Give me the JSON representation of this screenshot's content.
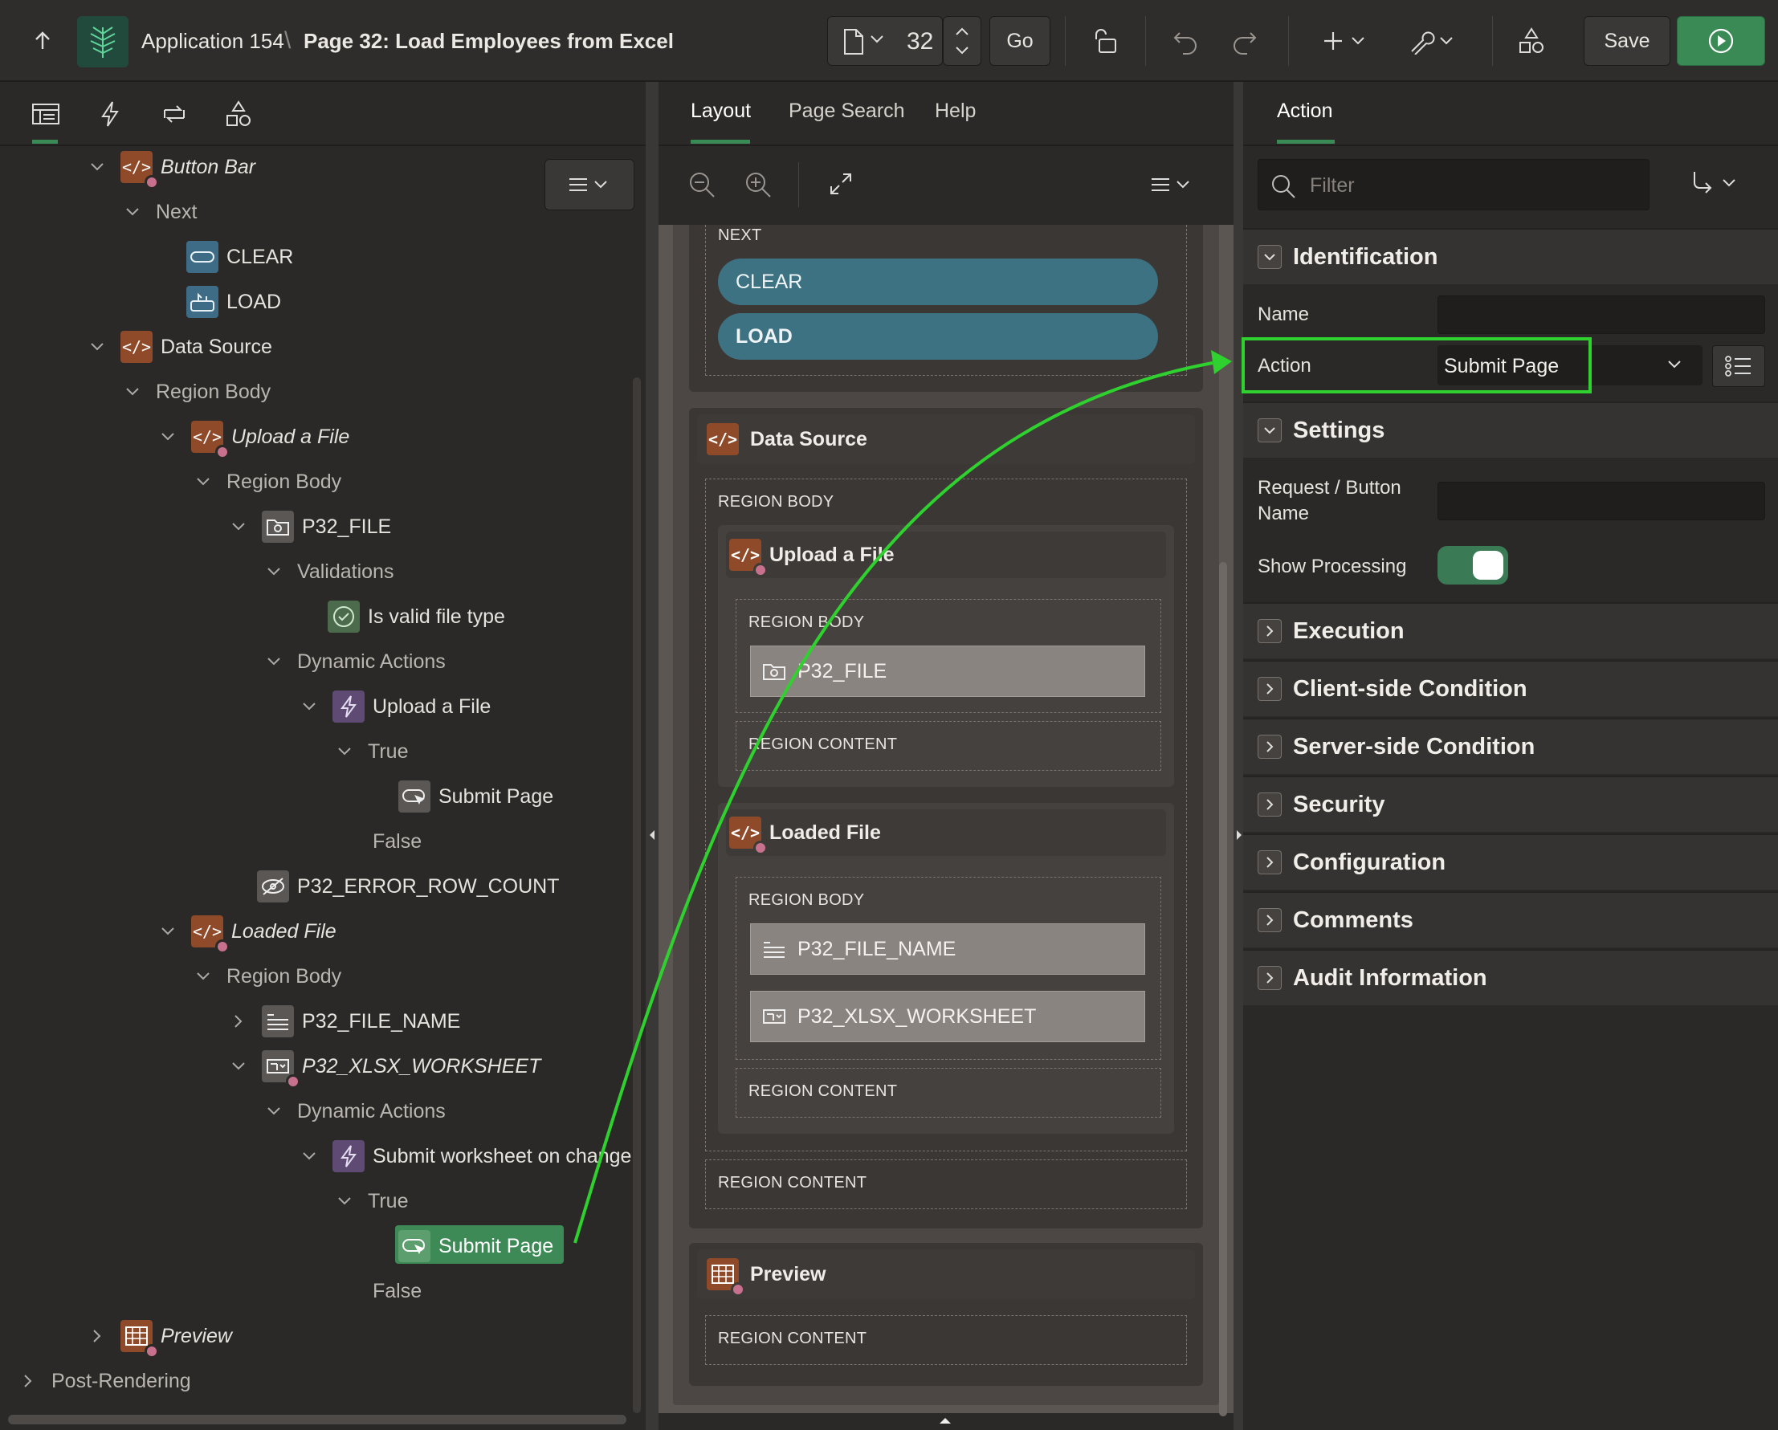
{
  "header": {
    "app_name": "Application 154",
    "separator": "\\",
    "page_title": "Page 32: Load Employees from Excel",
    "page_number": "32",
    "go_label": "Go",
    "save_label": "Save"
  },
  "tree": {
    "button_bar": "Button Bar",
    "next": "Next",
    "clear": "CLEAR",
    "load": "LOAD",
    "data_source": "Data Source",
    "region_body_1": "Region Body",
    "upload_file": "Upload a File",
    "region_body_2": "Region Body",
    "p32_file": "P32_FILE",
    "validations": "Validations",
    "valid_file_type": "Is valid file type",
    "dynamic_actions_1": "Dynamic Actions",
    "da_upload": "Upload a File",
    "true_1": "True",
    "submit_page_1": "Submit Page",
    "false_1": "False",
    "error_row_count": "P32_ERROR_ROW_COUNT",
    "loaded_file": "Loaded File",
    "region_body_3": "Region Body",
    "file_name": "P32_FILE_NAME",
    "xlsx_worksheet": "P32_XLSX_WORKSHEET",
    "dynamic_actions_2": "Dynamic Actions",
    "da_submit_ws": "Submit worksheet on change",
    "true_2": "True",
    "submit_page_2": "Submit Page",
    "false_2": "False",
    "preview": "Preview",
    "post_rendering": "Post-Rendering"
  },
  "middle": {
    "tabs": [
      "Layout",
      "Page Search",
      "Help"
    ],
    "next_label": "NEXT",
    "clear_btn": "CLEAR",
    "load_btn": "LOAD",
    "data_source": "Data Source",
    "region_body": "REGION BODY",
    "upload_file": "Upload a File",
    "upload_region_body": "REGION BODY",
    "p32_file": "P32_FILE",
    "upload_region_content": "REGION CONTENT",
    "loaded_file": "Loaded File",
    "loaded_region_body": "REGION BODY",
    "file_name": "P32_FILE_NAME",
    "xlsx_worksheet": "P32_XLSX_WORKSHEET",
    "loaded_region_content": "REGION CONTENT",
    "ds_region_content": "REGION CONTENT",
    "preview": "Preview",
    "preview_region_content": "REGION CONTENT"
  },
  "right": {
    "tab": "Action",
    "filter_placeholder": "Filter",
    "identification": "Identification",
    "name_label": "Name",
    "action_label": "Action",
    "action_value": "Submit Page",
    "settings": "Settings",
    "request_label_1": "Request / Button",
    "request_label_2": "Name",
    "show_processing_label": "Show Processing",
    "execution": "Execution",
    "client_condition": "Client-side Condition",
    "server_condition": "Server-side Condition",
    "security": "Security",
    "configuration": "Configuration",
    "comments": "Comments",
    "audit": "Audit Information"
  },
  "colors": {
    "highlight": "#2fd12f",
    "toggle_on": "#3a7a55",
    "run_button": "#3a8a55",
    "region_icon": "#8f4a2a",
    "button_pill": "#3d7283"
  }
}
